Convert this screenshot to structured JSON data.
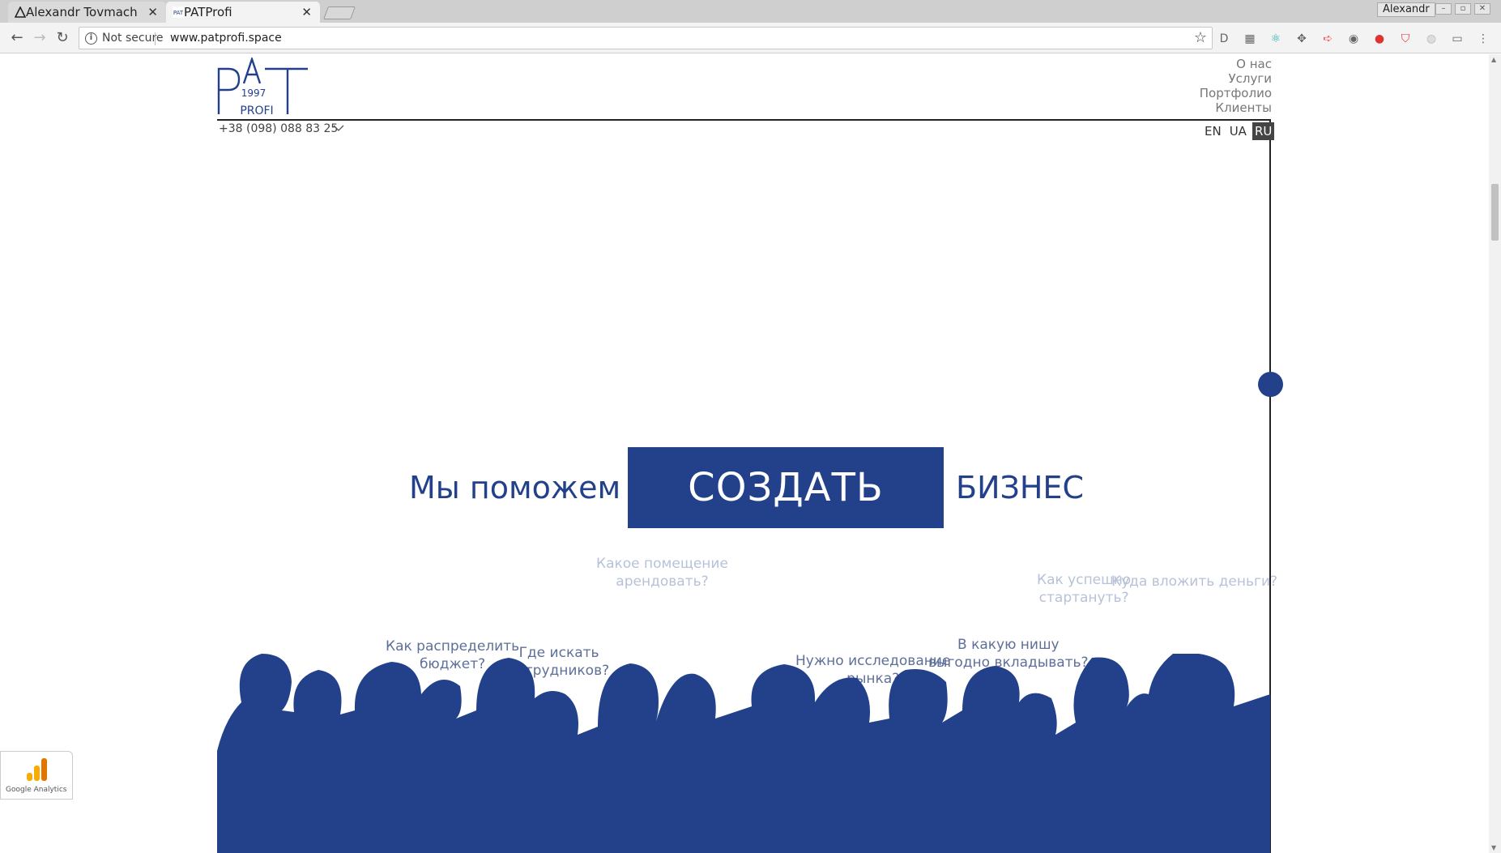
{
  "browser": {
    "tabs": [
      {
        "title": "Alexandr Tovmach | ...",
        "active": false
      },
      {
        "title": "PATProfi",
        "active": true
      }
    ],
    "profile_name": "Alexandr",
    "security_label": "Not secure",
    "url": "www.patprofi.space"
  },
  "site": {
    "logo": {
      "top": "PAT",
      "year": "1997",
      "bottom": "PROFI"
    },
    "phone": "+38 (098) 088 83 25",
    "menu": [
      "О нас",
      "Услуги",
      "Портфолио",
      "Клиенты"
    ],
    "languages": [
      "EN",
      "UA",
      "RU"
    ],
    "active_language": "RU",
    "accent_color": "#22418a"
  },
  "hero": {
    "left_text": "Мы поможем",
    "box_text": "СОЗДАТЬ",
    "right_text": "БИЗНЕС"
  },
  "questions": [
    "Какое помещение",
    "арендовать?",
    "Как успешно",
    "стартануть?",
    "Куда вложить деньги?",
    "Как распределить",
    "бюджет?",
    "Где искать",
    "сотрудников?",
    "Нужно исследование",
    "рынка?",
    "В какую нишу",
    "выгодно вкладывать?"
  ],
  "google_analytics_label": "Google Analytics"
}
